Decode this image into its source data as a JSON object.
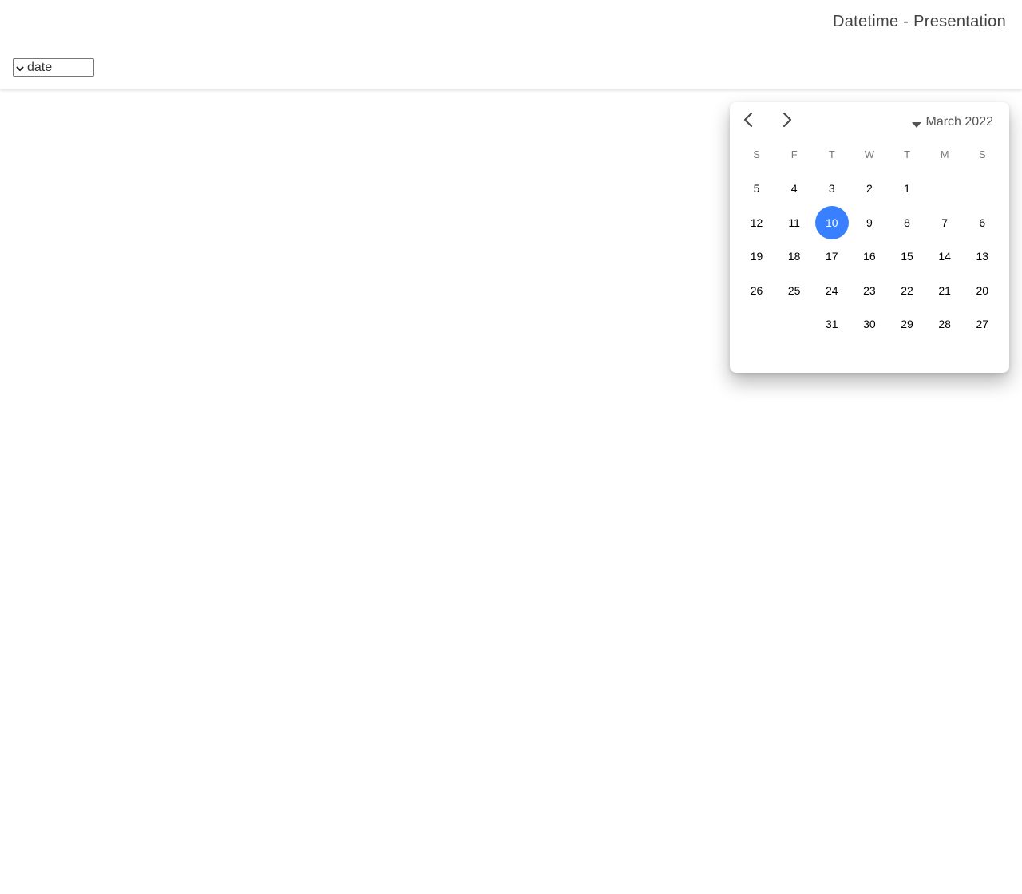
{
  "header": {
    "title": "Datetime - Presentation"
  },
  "presentation_select": {
    "value": "date"
  },
  "calendar": {
    "month_label": "March 2022",
    "accent_color": "#3880ff",
    "weekdays": [
      "S",
      "F",
      "T",
      "W",
      "T",
      "M",
      "S"
    ],
    "weeks": [
      [
        "5",
        "4",
        "3",
        "2",
        "1",
        "",
        ""
      ],
      [
        "12",
        "11",
        "10",
        "9",
        "8",
        "7",
        "6"
      ],
      [
        "19",
        "18",
        "17",
        "16",
        "15",
        "14",
        "13"
      ],
      [
        "26",
        "25",
        "24",
        "23",
        "22",
        "21",
        "20"
      ],
      [
        "",
        "",
        "31",
        "30",
        "29",
        "28",
        "27"
      ]
    ],
    "selected_day": "10",
    "icons": {
      "prev": "chevron-left-icon",
      "next": "chevron-right-icon",
      "month": "caret-down-icon",
      "select": "chevron-down-icon"
    }
  }
}
